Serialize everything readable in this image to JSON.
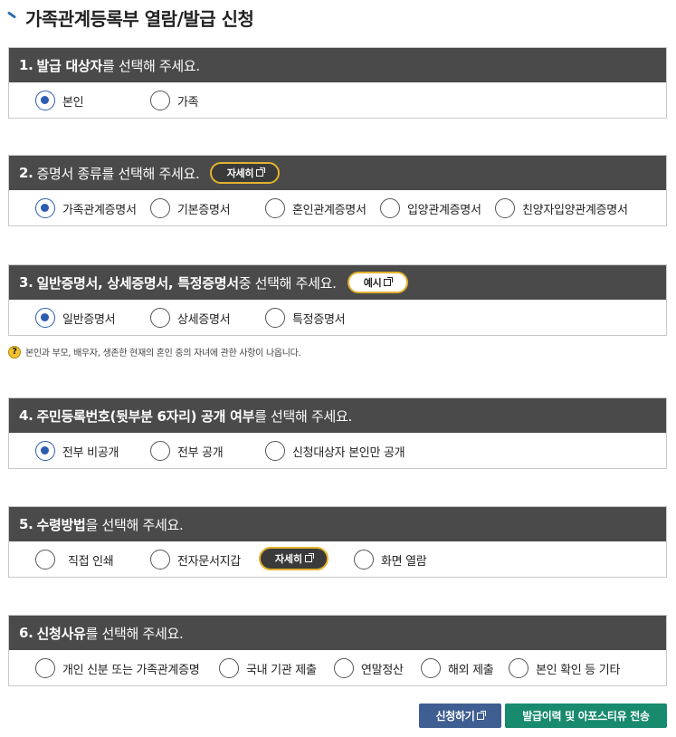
{
  "title": "가족관계등록부 열람/발급 신청",
  "sections": [
    {
      "num": "1.",
      "strong": "발급 대상자",
      "rest": "를 선택해 주세요.",
      "options": [
        "본인",
        "가족"
      ],
      "selected": 0
    },
    {
      "num": "2.",
      "strong": "",
      "rest": "증명서 종류를 선택해 주세요.",
      "pill": "자세히",
      "options": [
        "가족관계증명서",
        "기본증명서",
        "혼인관계증명서",
        "입양관계증명서",
        "친양자입양관계증명서"
      ],
      "selected": 0
    },
    {
      "num": "3.",
      "strong": "일반증명서, 상세증명서, 특정증명서",
      "rest": " 중 선택해 주세요.",
      "pill": "예시",
      "options": [
        "일반증명서",
        "상세증명서",
        "특정증명서"
      ],
      "selected": 0
    },
    {
      "num": "4.",
      "strong": "주민등록번호(뒷부분 6자리) 공개 여부",
      "rest": "를 선택해 주세요.",
      "options": [
        "전부 비공개",
        "전부 공개",
        "신청대상자 본인만 공개"
      ],
      "selected": 0
    },
    {
      "num": "5.",
      "strong": "수령방법",
      "rest": "을 선택해 주세요.",
      "options": [
        "직접 인쇄",
        "전자문서지갑",
        "화면 열람"
      ],
      "inline_pill": "자세히",
      "selected": -1
    },
    {
      "num": "6.",
      "strong": "신청사유",
      "rest": "를 선택해 주세요.",
      "options": [
        "개인 신분 또는 가족관계증명",
        "국내 기관 제출",
        "연말정산",
        "해외 제출",
        "본인 확인 등 기타"
      ],
      "selected": -1
    }
  ],
  "note": {
    "icon": "?",
    "text": "본인과 부모, 배우자, 생존한 현재의 혼인 중의 자녀에 관한 사항이 나옵니다."
  },
  "buttons": {
    "apply": "신청하기",
    "send": "발급이력 및 아포스티유 전송"
  },
  "colors": {
    "header_bg": "#4a4a4a",
    "radio_checked": "#2a5db0",
    "pill_border": "#e2b22e",
    "apply_btn": "#3f5e91",
    "send_btn": "#188a6e"
  }
}
